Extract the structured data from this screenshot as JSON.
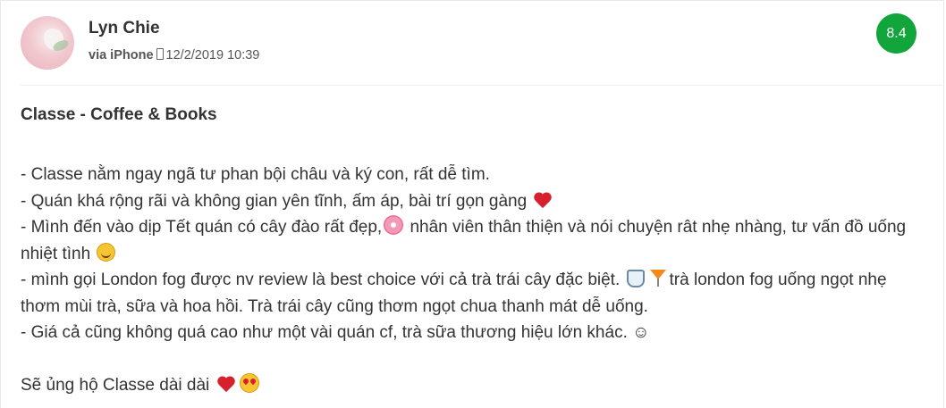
{
  "review": {
    "author": "Lyn Chie",
    "via_label": "via iPhone",
    "timestamp": "12/2/2019 10:39",
    "score": "8.4",
    "title": "Classe - Coffee & Books",
    "lines": {
      "l1": "- Classe nằm ngay ngã tư phan bội châu và ký con, rất dễ tìm.",
      "l2": "- Quán khá rộng rãi và không gian yên tĩnh, ấm áp, bài trí gọn gàng",
      "l3a": "- Mình đến vào dịp Tết quán có cây đào rất đẹp,",
      "l3b": " nhân viên thân thiện và nói chuyện rât nhẹ nhàng, tư vấn đồ uống nhiệt tình",
      "l4a": "- mình gọi London fog được nv review là best choice với cả trà trái cây đặc biệt.",
      "l4b": "trà london fog uống ngọt nhẹ thơm mùi trà, sữa và hoa hồi. Trà trái cây cũng thơm ngọt chua thanh mát dễ uống.",
      "l5": "- Giá cả cũng không quá cao như một vài quán cf, trà sữa thương hiệu lớn khác. ☺",
      "l6": "Sẽ ủng hộ Classe dài dài"
    }
  },
  "icons": {
    "avatar": "avatar-photo",
    "device": "phone-icon",
    "emoji_1": "heart-icon",
    "emoji_2": "cherry-blossom-icon",
    "emoji_3": "smiling-face-icon",
    "emoji_4": "cup-icon",
    "emoji_5": "cocktail-icon",
    "emoji_6": "heart-icon",
    "emoji_7": "heart-eyes-icon"
  },
  "colors": {
    "score_badge": "#12a53c",
    "text": "#333333",
    "meta_text": "#555555"
  }
}
